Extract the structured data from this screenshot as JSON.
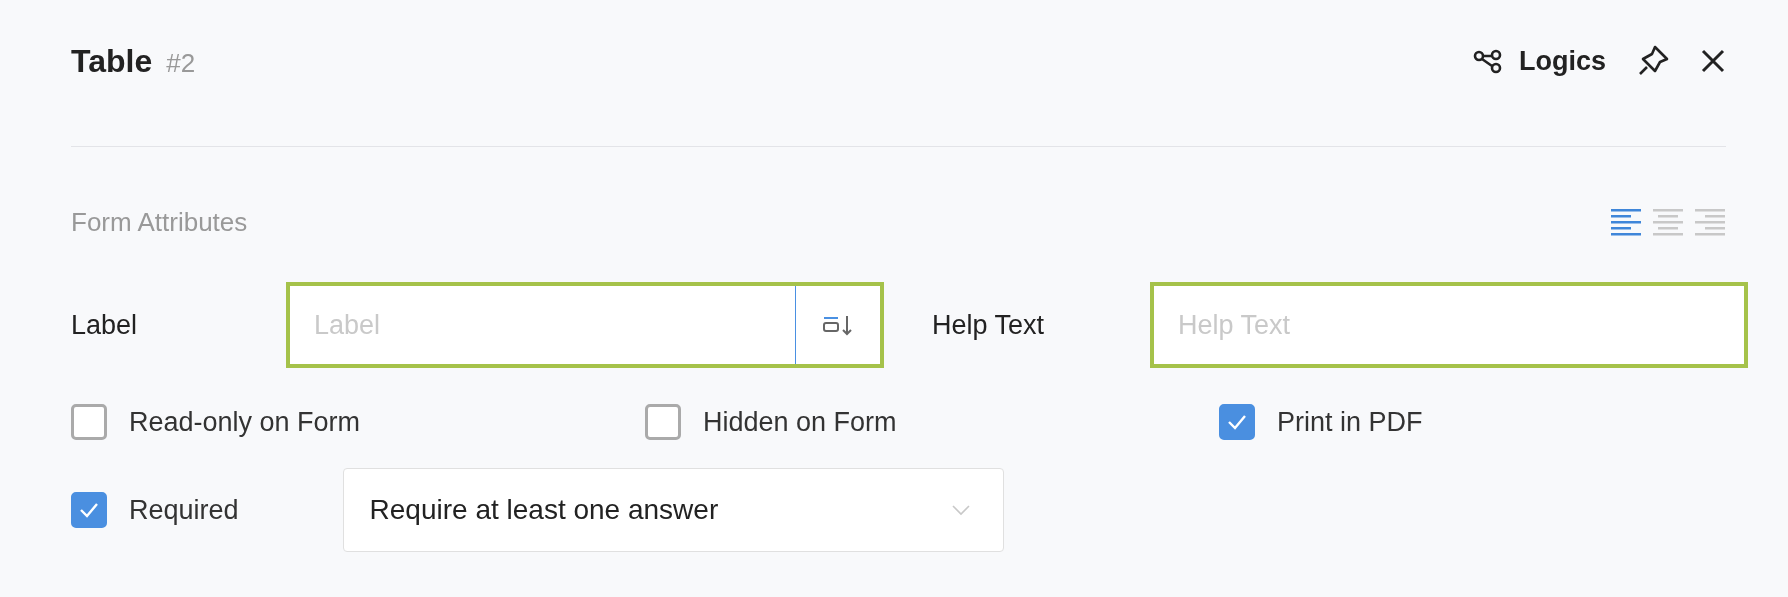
{
  "header": {
    "title": "Table",
    "number": "#2",
    "logics_label": "Logics"
  },
  "section": {
    "title": "Form Attributes",
    "alignments": [
      {
        "kind": "left",
        "selected": true
      },
      {
        "kind": "center",
        "selected": false
      },
      {
        "kind": "right",
        "selected": false
      }
    ]
  },
  "fields": [
    {
      "label": "Label",
      "placeholder": "Label",
      "highlighted": true,
      "has_action": true
    },
    {
      "label": "Help Text",
      "placeholder": "Help Text",
      "highlighted": true,
      "has_action": false
    }
  ],
  "options": [
    {
      "label": "Read-only on Form",
      "checked": false
    },
    {
      "label": "Hidden on Form",
      "checked": false
    },
    {
      "label": "Print in PDF",
      "checked": true
    }
  ],
  "required": {
    "label": "Required",
    "checked": true,
    "select_value": "Require at least one answer"
  }
}
